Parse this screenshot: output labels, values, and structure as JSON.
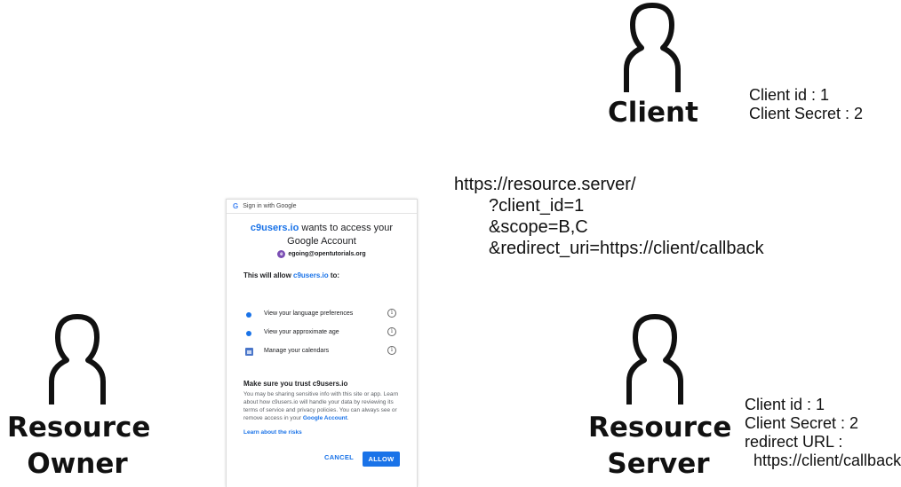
{
  "client": {
    "label": "Client",
    "info": [
      "Client id : 1",
      "Client Secret : 2"
    ]
  },
  "resource_owner": {
    "label_lines": [
      "Resource",
      "Owner"
    ]
  },
  "resource_server": {
    "label_lines": [
      "Resource",
      "Server"
    ],
    "info": [
      "Client id : 1",
      "Client Secret : 2",
      "redirect URL :",
      "  https://client/callback"
    ]
  },
  "request_url": {
    "lines": [
      "https://resource.server/",
      "?client_id=1",
      "&scope=B,C",
      "&redirect_uri=https://client/callback"
    ]
  },
  "consent_dialog": {
    "header": "Sign in with Google",
    "header_icon": "G",
    "title_brand": "c9users.io",
    "title_rest_1": " wants to access your",
    "title_line_2": "Google Account",
    "account_initial": "e",
    "account_email": "egoing@opentutorials.org",
    "allow_prefix": "This will allow ",
    "allow_brand": "c9users.io",
    "allow_suffix": " to:",
    "permissions": [
      {
        "text": "View your language preferences",
        "icon": "dot-icon"
      },
      {
        "text": "View your approximate age",
        "icon": "dot-icon"
      },
      {
        "text": "Manage your calendars",
        "icon": "calendar-icon"
      }
    ],
    "trust_heading": "Make sure you trust c9users.io",
    "trust_body": "You may be sharing sensitive info with this site or app. Learn about how c9users.io will handle your data by reviewing its terms of service and privacy policies. You can always see or remove access in your ",
    "trust_link": "Google Account",
    "trust_end": ".",
    "learn_link": "Learn about the risks",
    "cancel_label": "CANCEL",
    "allow_label": "ALLOW",
    "accent_color": "#1a73e8"
  }
}
